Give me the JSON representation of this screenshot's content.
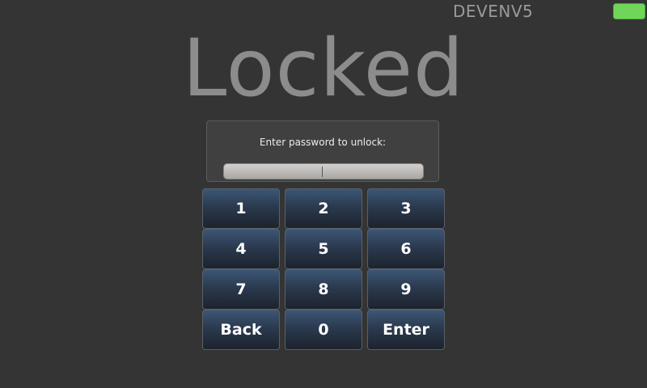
{
  "header": {
    "device_name": "DEVENV5",
    "status_color": "#6fd65a"
  },
  "lock_screen": {
    "title": "Locked",
    "prompt": "Enter password to unlock:",
    "password_value": "",
    "password_placeholder": ""
  },
  "keypad": {
    "keys": [
      {
        "label": "1"
      },
      {
        "label": "2"
      },
      {
        "label": "3"
      },
      {
        "label": "4"
      },
      {
        "label": "5"
      },
      {
        "label": "6"
      },
      {
        "label": "7"
      },
      {
        "label": "8"
      },
      {
        "label": "9"
      },
      {
        "label": "Back"
      },
      {
        "label": "0"
      },
      {
        "label": "Enter"
      }
    ]
  },
  "colors": {
    "background": "#343434",
    "title": "#8c8c8c",
    "key_top": "#3c5676",
    "key_bottom": "#1c232d"
  }
}
